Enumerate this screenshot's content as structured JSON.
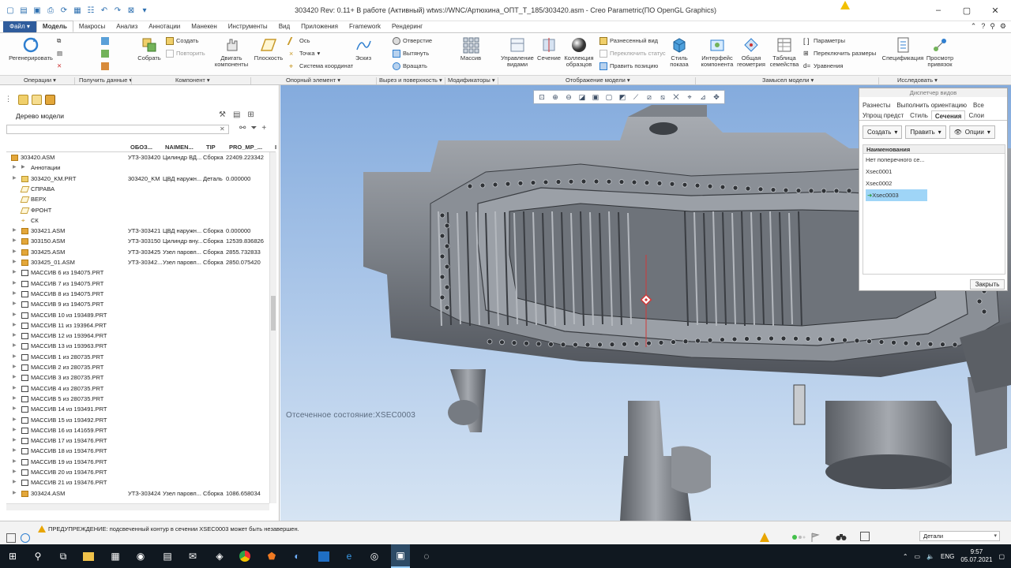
{
  "window": {
    "title": "303420 Rev: 0.11+ В работе  (Активный) wtws://WNC/Артюхина_ОПТ_Т_185/303420.asm - Creo Parametric(ПО OpenGL Graphics)"
  },
  "tabs": [
    {
      "label": "Файл ▾"
    },
    {
      "label": "Модель"
    },
    {
      "label": "Макросы"
    },
    {
      "label": "Анализ"
    },
    {
      "label": "Аннотации"
    },
    {
      "label": "Манекен"
    },
    {
      "label": "Инструменты"
    },
    {
      "label": "Вид"
    },
    {
      "label": "Приложения"
    },
    {
      "label": "Framework"
    },
    {
      "label": "Рендеринг"
    }
  ],
  "ribbon": {
    "regen": "Регенерировать",
    "assemble": "Собрать",
    "create": "Создать",
    "repeat": "Повторить",
    "drag": "Двигать компоненты",
    "plane": "Плоскость",
    "axis": "Ось",
    "point": "Точка",
    "csys": "Система координат",
    "sketch": "Эскиз",
    "hole": "Отверстие",
    "extrude": "Вытянуть",
    "revolve": "Вращать",
    "pattern": "Массив",
    "manage_views": "Управление видами",
    "section": "Сечение",
    "appearance": "Коллекция образцов",
    "exploded": "Разнесенный вид",
    "toggle_status": "Переключить статус",
    "edit_position": "Править позицию",
    "display_style": "Стиль показа",
    "component_interface": "Интерфейс компонента",
    "common_geometry": "Общая геометрия",
    "family_table": "Таблица семейства",
    "parameters": "Параметры",
    "switch_dims": "Переключить размеры",
    "relations": "Уравнения",
    "spec": "Спецификация",
    "refs": "Просмотр привязок"
  },
  "groups": [
    {
      "label": "Операции ▾"
    },
    {
      "label": "Получить данные ▾"
    },
    {
      "label": "Компонент ▾"
    },
    {
      "label": "Опорный элемент ▾"
    },
    {
      "label": "Вырез и поверхность ▾"
    },
    {
      "label": "Модификаторы ▾"
    },
    {
      "label": "Отображение модели ▾"
    },
    {
      "label": "Замысел модели ▾"
    },
    {
      "label": "Исследовать ▾"
    }
  ],
  "tree": {
    "title": "Дерево модели",
    "columns": [
      "ОБОЗ...",
      "NAIMEN...",
      "TIP",
      "PRO_MP_...",
      "I"
    ],
    "rows": [
      {
        "name": "303420.ASM",
        "icon": "asm",
        "oboz": "УТЗ-303420",
        "naim": "Цилиндр ВД...",
        "tip": "Сборка",
        "mp": "22409.223342"
      },
      {
        "name": "Аннотации",
        "icon": "ann",
        "oboz": "",
        "naim": "",
        "tip": "",
        "mp": ""
      },
      {
        "name": "303420_KM.PRT",
        "icon": "prt",
        "oboz": "303420_KM",
        "naim": "ЦВД наружн...",
        "tip": "Деталь",
        "mp": "0.000000"
      },
      {
        "name": "СПРАВА",
        "icon": "plane",
        "oboz": "",
        "naim": "",
        "tip": "",
        "mp": ""
      },
      {
        "name": "ВЕРХ",
        "icon": "plane",
        "oboz": "",
        "naim": "",
        "tip": "",
        "mp": ""
      },
      {
        "name": "ФРОНТ",
        "icon": "plane",
        "oboz": "",
        "naim": "",
        "tip": "",
        "mp": ""
      },
      {
        "name": "СК",
        "icon": "csys",
        "oboz": "",
        "naim": "",
        "tip": "",
        "mp": ""
      },
      {
        "name": "303421.ASM",
        "icon": "asm",
        "oboz": "УТЗ-303421",
        "naim": "ЦВД наружн...",
        "tip": "Сборка",
        "mp": "0.000000"
      },
      {
        "name": "303150.ASM",
        "icon": "asm",
        "oboz": "УТЗ-303150",
        "naim": "Цилиндр вну...",
        "tip": "Сборка",
        "mp": "12539.836826"
      },
      {
        "name": "303425.ASM",
        "icon": "asm",
        "oboz": "УТЗ-303425",
        "naim": "Узел паровп...",
        "tip": "Сборка",
        "mp": "2855.732833"
      },
      {
        "name": "303425_01.ASM",
        "icon": "asm",
        "oboz": "УТЗ-30342...",
        "naim": "Узел паровп...",
        "tip": "Сборка",
        "mp": "2850.075420"
      },
      {
        "name": "МАССИВ 6 из 194075.PRT",
        "icon": "pat",
        "oboz": "",
        "naim": "",
        "tip": "",
        "mp": ""
      },
      {
        "name": "МАССИВ 7 из 194075.PRT",
        "icon": "pat",
        "oboz": "",
        "naim": "",
        "tip": "",
        "mp": ""
      },
      {
        "name": "МАССИВ 8 из 194075.PRT",
        "icon": "pat",
        "oboz": "",
        "naim": "",
        "tip": "",
        "mp": ""
      },
      {
        "name": "МАССИВ 9 из 194075.PRT",
        "icon": "pat",
        "oboz": "",
        "naim": "",
        "tip": "",
        "mp": ""
      },
      {
        "name": "МАССИВ 10 из 193489.PRT",
        "icon": "pat",
        "oboz": "",
        "naim": "",
        "tip": "",
        "mp": ""
      },
      {
        "name": "МАССИВ 11 из 193964.PRT",
        "icon": "pat",
        "oboz": "",
        "naim": "",
        "tip": "",
        "mp": ""
      },
      {
        "name": "МАССИВ 12 из 193964.PRT",
        "icon": "pat",
        "oboz": "",
        "naim": "",
        "tip": "",
        "mp": ""
      },
      {
        "name": "МАССИВ 13 из 193963.PRT",
        "icon": "pat",
        "oboz": "",
        "naim": "",
        "tip": "",
        "mp": ""
      },
      {
        "name": "МАССИВ 1 из 280735.PRT",
        "icon": "pat",
        "oboz": "",
        "naim": "",
        "tip": "",
        "mp": ""
      },
      {
        "name": "МАССИВ 2 из 280735.PRT",
        "icon": "pat",
        "oboz": "",
        "naim": "",
        "tip": "",
        "mp": ""
      },
      {
        "name": "МАССИВ 3 из 280735.PRT",
        "icon": "pat",
        "oboz": "",
        "naim": "",
        "tip": "",
        "mp": ""
      },
      {
        "name": "МАССИВ 4 из 280735.PRT",
        "icon": "pat",
        "oboz": "",
        "naim": "",
        "tip": "",
        "mp": ""
      },
      {
        "name": "МАССИВ 5 из 280735.PRT",
        "icon": "pat",
        "oboz": "",
        "naim": "",
        "tip": "",
        "mp": ""
      },
      {
        "name": "МАССИВ 14 из 193491.PRT",
        "icon": "pat",
        "oboz": "",
        "naim": "",
        "tip": "",
        "mp": ""
      },
      {
        "name": "МАССИВ 15 из 193492.PRT",
        "icon": "pat",
        "oboz": "",
        "naim": "",
        "tip": "",
        "mp": ""
      },
      {
        "name": "МАССИВ 16 из 141659.PRT",
        "icon": "pat",
        "oboz": "",
        "naim": "",
        "tip": "",
        "mp": ""
      },
      {
        "name": "МАССИВ 17 из 193476.PRT",
        "icon": "pat",
        "oboz": "",
        "naim": "",
        "tip": "",
        "mp": ""
      },
      {
        "name": "МАССИВ 18 из 193476.PRT",
        "icon": "pat",
        "oboz": "",
        "naim": "",
        "tip": "",
        "mp": ""
      },
      {
        "name": "МАССИВ 19 из 193476.PRT",
        "icon": "pat",
        "oboz": "",
        "naim": "",
        "tip": "",
        "mp": ""
      },
      {
        "name": "МАССИВ 20 из 193476.PRT",
        "icon": "pat",
        "oboz": "",
        "naim": "",
        "tip": "",
        "mp": ""
      },
      {
        "name": "МАССИВ 21 из 193476.PRT",
        "icon": "pat",
        "oboz": "",
        "naim": "",
        "tip": "",
        "mp": ""
      },
      {
        "name": "303424.ASM",
        "icon": "asm",
        "oboz": "УТЗ-303424",
        "naim": "Узел паровп...",
        "tip": "Сборка",
        "mp": "1086.658034"
      }
    ]
  },
  "viewport": {
    "state_label": "Отсеченное состояние:XSEC0003"
  },
  "view_manager": {
    "title": "Диспетчер видов",
    "tabs_row1": [
      "Разнесты",
      "Выполнить ориентацию",
      "Все"
    ],
    "tabs_row2": [
      "Упрощ предст",
      "Стиль",
      "Сечения",
      "Слои"
    ],
    "active_tab": "Сечения",
    "create": "Создать",
    "edit": "Править",
    "options": "Опции",
    "list_header": "Наименования",
    "items": [
      "Нет поперечного се...",
      "Xsec0001",
      "Xsec0002",
      "Xsec0003"
    ],
    "selected": "Xsec0003",
    "close": "Закрыть"
  },
  "status": {
    "message": "ПРЕДУПРЕЖДЕНИЕ: подсвеченный контур в сечении XSEC0003 может быть незавершен.",
    "filter": "Детали"
  },
  "taskbar": {
    "lang": "ENG",
    "time": "9:57",
    "date": "05.07.2021"
  },
  "colors": {
    "file_tab": "#2f5c9c",
    "selection": "#9fd5f7",
    "viewport_top": "#84abdd",
    "viewport_bottom": "#d6e4f3",
    "model_gray": "#8c9198",
    "warning": "#e8a500"
  }
}
